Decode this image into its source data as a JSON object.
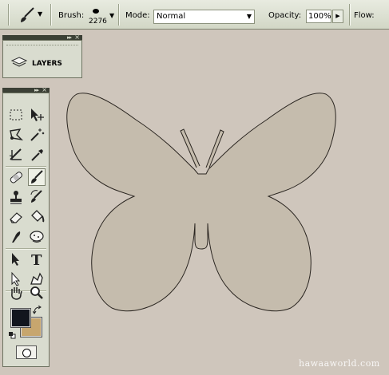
{
  "options_bar": {
    "brush_label": "Brush:",
    "brush_size": "2276",
    "mode_label": "Mode:",
    "mode_value": "Normal",
    "opacity_label": "Opacity:",
    "opacity_value": "100%",
    "flow_label": "Flow:"
  },
  "layers_panel": {
    "label": "LAYERS"
  },
  "toolbox": {
    "foreground_color": "#12151e",
    "background_color": "#c7a66e",
    "active_tool": "brush-tool"
  },
  "canvas": {
    "background_color": "#cfc6bc",
    "shape_fill": "#c5bcad",
    "shape_stroke": "#2a2520"
  },
  "watermark": "hawaaworld.com"
}
